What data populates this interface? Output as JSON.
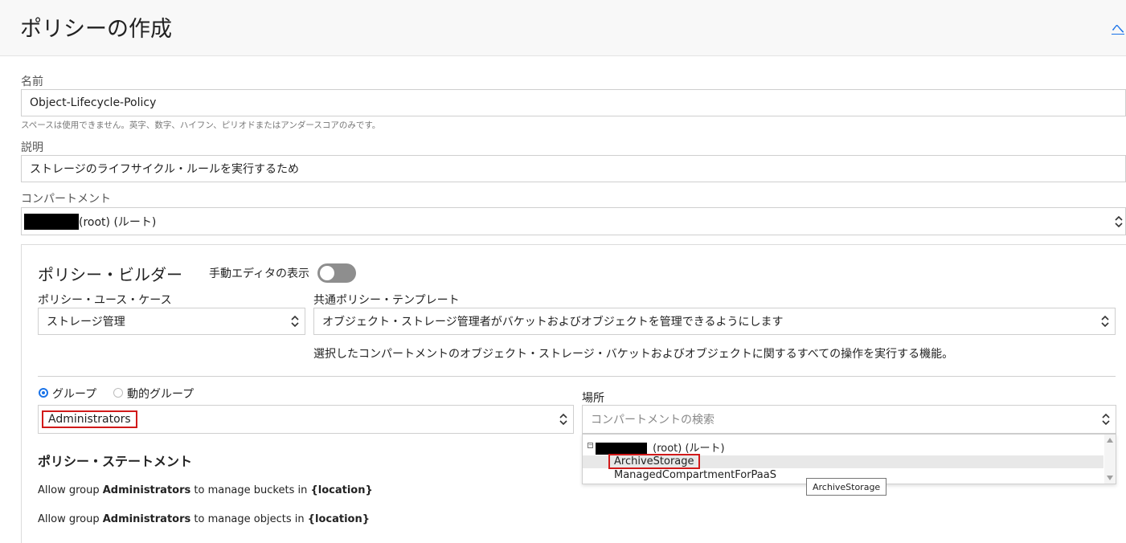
{
  "header": {
    "title": "ポリシーの作成",
    "collapse_glyph": "へ"
  },
  "name": {
    "label": "名前",
    "value": "Object-Lifecycle-Policy",
    "hint": "スペースは使用できません。英字、数字、ハイフン、ピリオドまたはアンダースコアのみです。"
  },
  "description": {
    "label": "説明",
    "value": "ストレージのライフサイクル・ルールを実行するため"
  },
  "compartment": {
    "label": "コンパートメント",
    "value_suffix": "(root) (ルート)"
  },
  "builder": {
    "title": "ポリシー・ビルダー",
    "manual_editor_label": "手動エディタの表示",
    "manual_editor_on": false,
    "use_case_label": "ポリシー・ユース・ケース",
    "use_case_value": "ストレージ管理",
    "template_label": "共通ポリシー・テンプレート",
    "template_value": "オブジェクト・ストレージ管理者がバケットおよびオブジェクトを管理できるようにします",
    "template_description": "選択したコンパートメントのオブジェクト・ストレージ・バケットおよびオブジェクトに関するすべての操作を実行する機能。",
    "group_radio_label": "グループ",
    "dynamic_group_radio_label": "動的グループ",
    "group_value": "Administrators",
    "location_label": "場所",
    "location_placeholder": "コンパートメントの検索",
    "location_options": {
      "root_suffix": "(root) (ルート)",
      "items": [
        "ArchiveStorage",
        "ManagedCompartmentForPaaS"
      ]
    },
    "tooltip": "ArchiveStorage",
    "statement_title": "ポリシー・ステートメント",
    "statements": [
      {
        "prefix": "Allow group ",
        "group": "Administrators",
        "middle": " to manage buckets in ",
        "location": "{location}"
      },
      {
        "prefix": "Allow group ",
        "group": "Administrators",
        "middle": " to manage objects in ",
        "location": "{location}"
      }
    ]
  },
  "colors": {
    "accent": "#1a73e8",
    "highlight_border": "#d11a1a",
    "toggle_off": "#8e8e8e"
  }
}
